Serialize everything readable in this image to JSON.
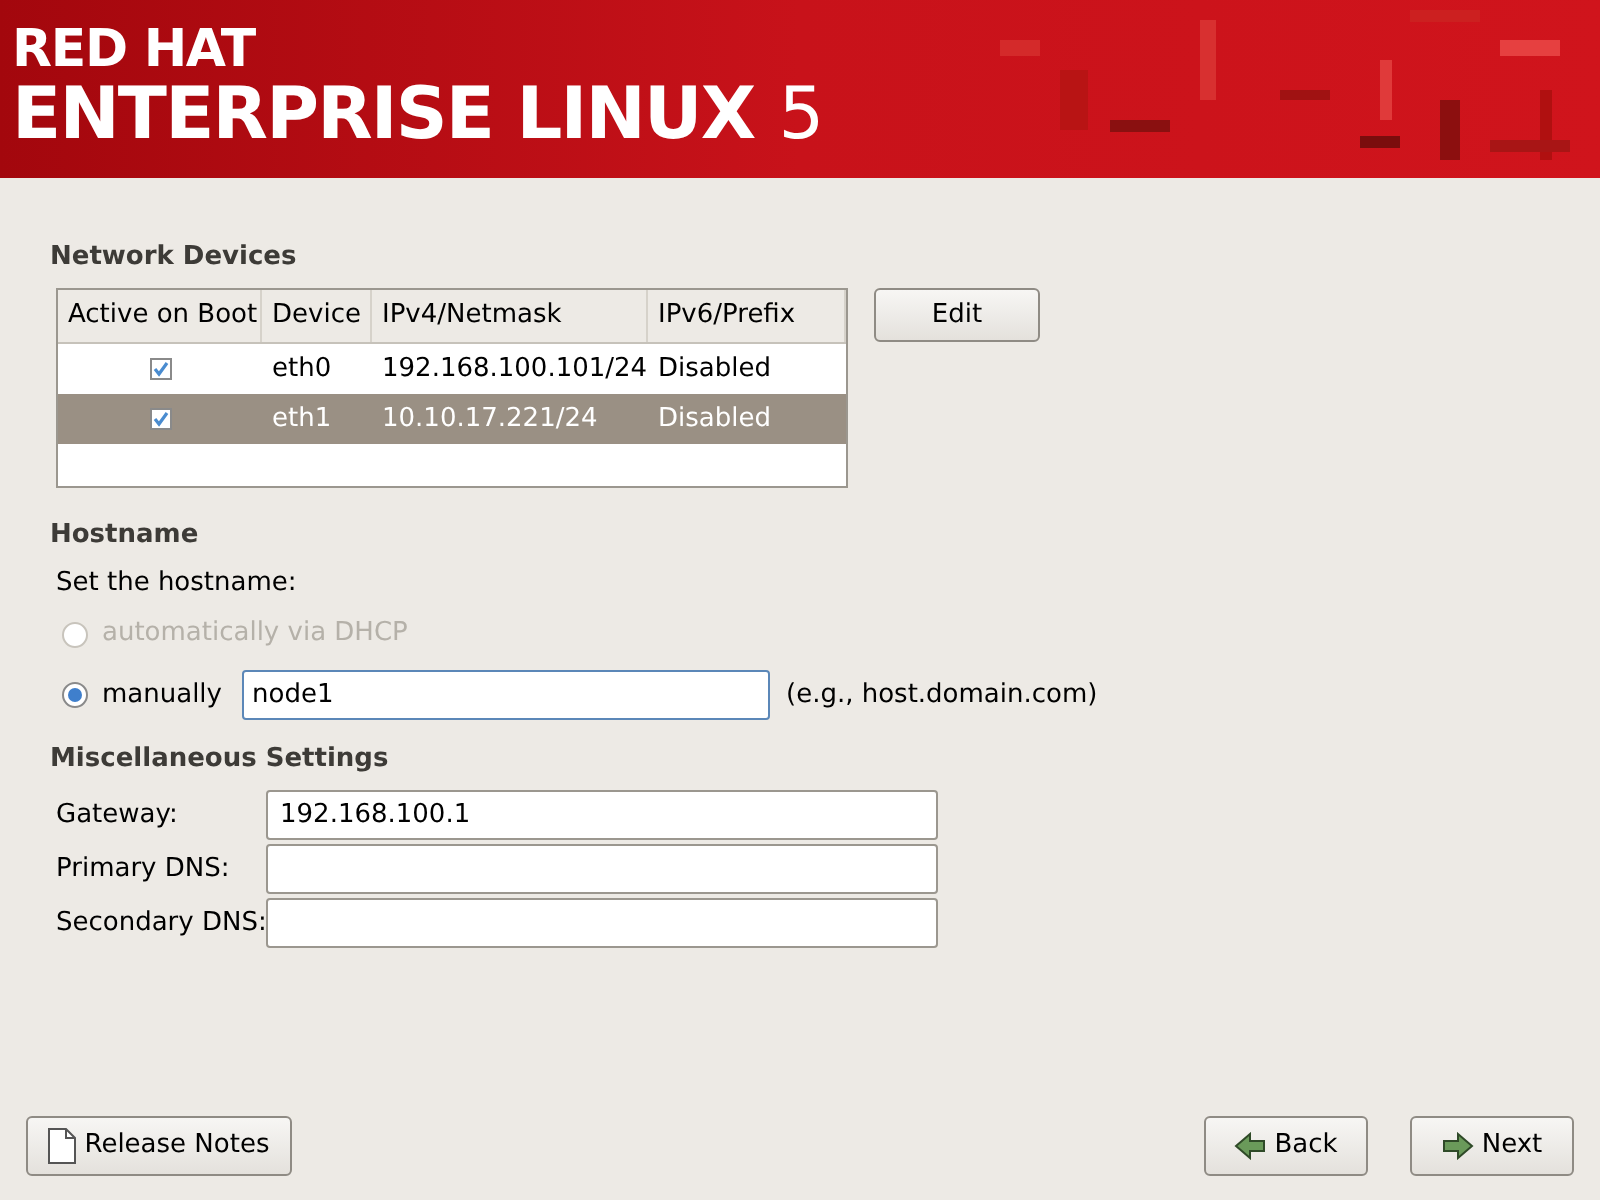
{
  "banner": {
    "line_1": "RED HAT",
    "line_2": "ENTERPRISE LINUX",
    "version": "5"
  },
  "network_devices": {
    "title": "Network Devices",
    "columns": [
      "Active on Boot",
      "Device",
      "IPv4/Netmask",
      "IPv6/Prefix"
    ],
    "rows": [
      {
        "active_on_boot": true,
        "device": "eth0",
        "ipv4": "192.168.100.101/24",
        "ipv6": "Disabled",
        "selected": false
      },
      {
        "active_on_boot": true,
        "device": "eth1",
        "ipv4": "10.10.17.221/24",
        "ipv6": "Disabled",
        "selected": true
      }
    ],
    "edit_button": "Edit"
  },
  "hostname": {
    "title": "Hostname",
    "prompt": "Set the hostname:",
    "options": [
      {
        "label": "automatically via DHCP",
        "selected": false,
        "disabled": true
      },
      {
        "label": "manually",
        "selected": true,
        "disabled": false,
        "value": "node1",
        "hint": "(e.g., host.domain.com)"
      }
    ]
  },
  "misc": {
    "title": "Miscellaneous Settings",
    "fields": [
      {
        "label": "Gateway:",
        "value": "192.168.100.1"
      },
      {
        "label": "Primary DNS:"
      },
      {
        "label": "Secondary DNS:"
      }
    ]
  },
  "buttons": {
    "release_notes": "Release Notes",
    "back": "Back",
    "next": "Next"
  }
}
